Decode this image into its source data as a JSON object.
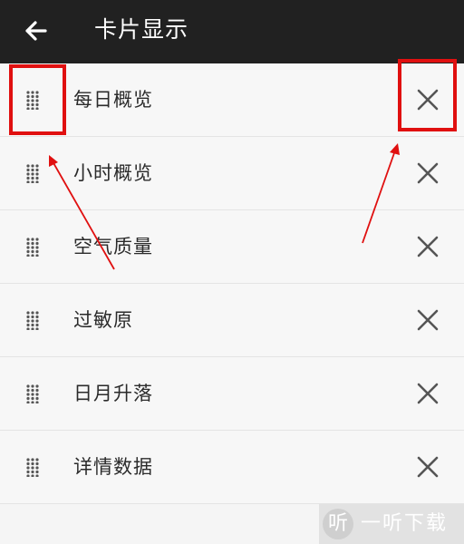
{
  "header": {
    "title": "卡片显示",
    "back_icon": "arrow-left-icon"
  },
  "cards": [
    {
      "label": "每日概览"
    },
    {
      "label": "小时概览"
    },
    {
      "label": "空气质量"
    },
    {
      "label": "过敏原"
    },
    {
      "label": "日月升落"
    },
    {
      "label": "详情数据"
    }
  ],
  "icons": {
    "handle": "drag-handle-icon",
    "remove": "close-icon"
  },
  "colors": {
    "topbar": "#212121",
    "background": "#f7f7f7",
    "icon": "#555555",
    "annotation": "#e01010"
  },
  "watermark": {
    "logo": "听",
    "text": "一听下载"
  }
}
